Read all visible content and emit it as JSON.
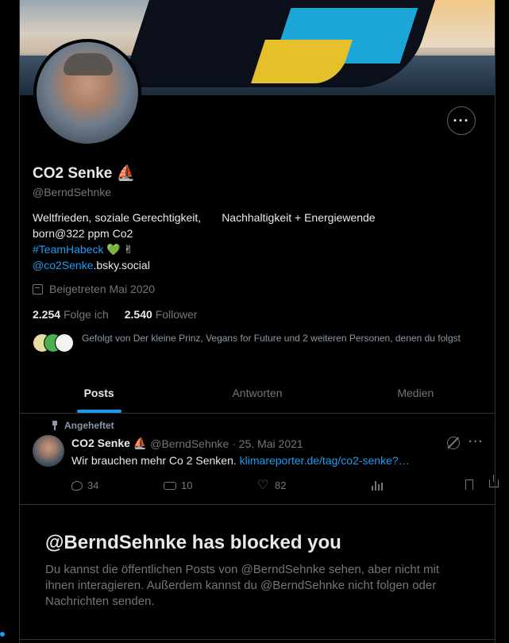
{
  "profile": {
    "display_name": "CO2 Senke ⛵",
    "handle": "@BerndSehnke",
    "bio_line1_a": "Weltfrieden, soziale Gerechtigkeit,",
    "bio_line1_b": "Nachhaltigkeit + Energiewende",
    "bio_line2": "born@322 ppm Co2",
    "bio_hashtag": "#TeamHabeck",
    "bio_hashtag_emoji": " 💚 ✌",
    "bio_mention": "@co2Senke",
    "bio_mention_suffix": ".bsky.social",
    "joined": "Beigetreten Mai 2020",
    "following_count": "2.254",
    "following_label": "Folge ich",
    "followers_count": "2.540",
    "followers_label": "Follower",
    "followed_by": "Gefolgt von Der kleine Prinz, Vegans for Future und 2 weiteren Personen, denen du folgst",
    "more_label": "···"
  },
  "tabs": [
    {
      "label": "Posts",
      "active": true
    },
    {
      "label": "Antworten",
      "active": false
    },
    {
      "label": "Medien",
      "active": false
    }
  ],
  "tweet": {
    "pinned_label": "Angeheftet",
    "author": "CO2 Senke ⛵",
    "meta": "@BerndSehnke · 25. Mai 2021",
    "text": "Wir brauchen mehr Co 2 Senken. ",
    "link": "klimareporter.de/tag/co2-senke?…",
    "more_label": "···",
    "replies": "34",
    "retweets": "10",
    "likes": "82"
  },
  "blocked": {
    "title": "@BerndSehnke has blocked you",
    "text": "Du kannst die öffentlichen Posts von @BerndSehnke sehen, aber nicht mit ihnen interagieren. Außerdem kannst du @BerndSehnke nicht folgen oder Nachrichten senden."
  },
  "colors": {
    "background": "#000000",
    "accent": "#1d9bf0",
    "muted": "#71767b",
    "text": "#e7e9ea"
  }
}
